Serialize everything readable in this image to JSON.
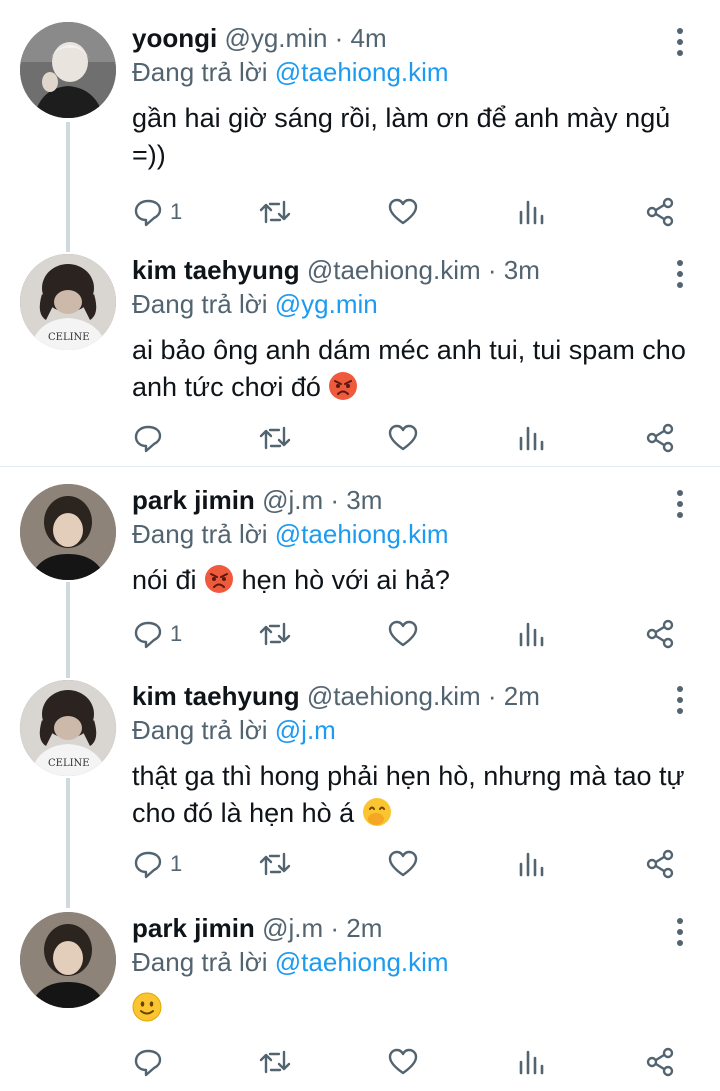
{
  "tweets": [
    {
      "name": "yoongi",
      "handle": "@yg.min",
      "time": "4m",
      "reply_prefix": "Đang trả lời ",
      "reply_to": "@taehiong.kim",
      "text": "gần hai giờ sáng rồi, làm ơn để anh mày ngủ =))",
      "reply_count": "1"
    },
    {
      "name": "kim taehyung",
      "handle": "@taehiong.kim",
      "time": "3m",
      "reply_prefix": "Đang trả lời ",
      "reply_to": "@yg.min",
      "text": "ai bảo ông anh dám méc anh tui, tui spam cho anh tức chơi đó",
      "reply_count": ""
    },
    {
      "name": "park jimin",
      "handle": "@j.m",
      "time": "3m",
      "reply_prefix": "Đang trả lời ",
      "reply_to": "@taehiong.kim",
      "text_before": "nói đi",
      "text_after": "hẹn hò với ai hả?",
      "reply_count": "1"
    },
    {
      "name": "kim taehyung",
      "handle": "@taehiong.kim",
      "time": "2m",
      "reply_prefix": "Đang trả lời ",
      "reply_to": "@j.m",
      "text": "thật ga thì hong phải hẹn hò, nhưng mà tao tự cho đó là hẹn hò á",
      "reply_count": "1"
    },
    {
      "name": "park jimin",
      "handle": "@j.m",
      "time": "2m",
      "reply_prefix": "Đang trả lời ",
      "reply_to": "@taehiong.kim",
      "reply_count": ""
    }
  ],
  "separator": " · ",
  "icons": {
    "reply": "comment-icon",
    "retweet": "retweet-icon",
    "like": "heart-icon",
    "views": "analytics-icon",
    "share": "share-icon",
    "more": "more-vertical-icon"
  },
  "colors": {
    "mention": "#1d9bf0",
    "secondary": "#536471",
    "text": "#0f1419"
  }
}
